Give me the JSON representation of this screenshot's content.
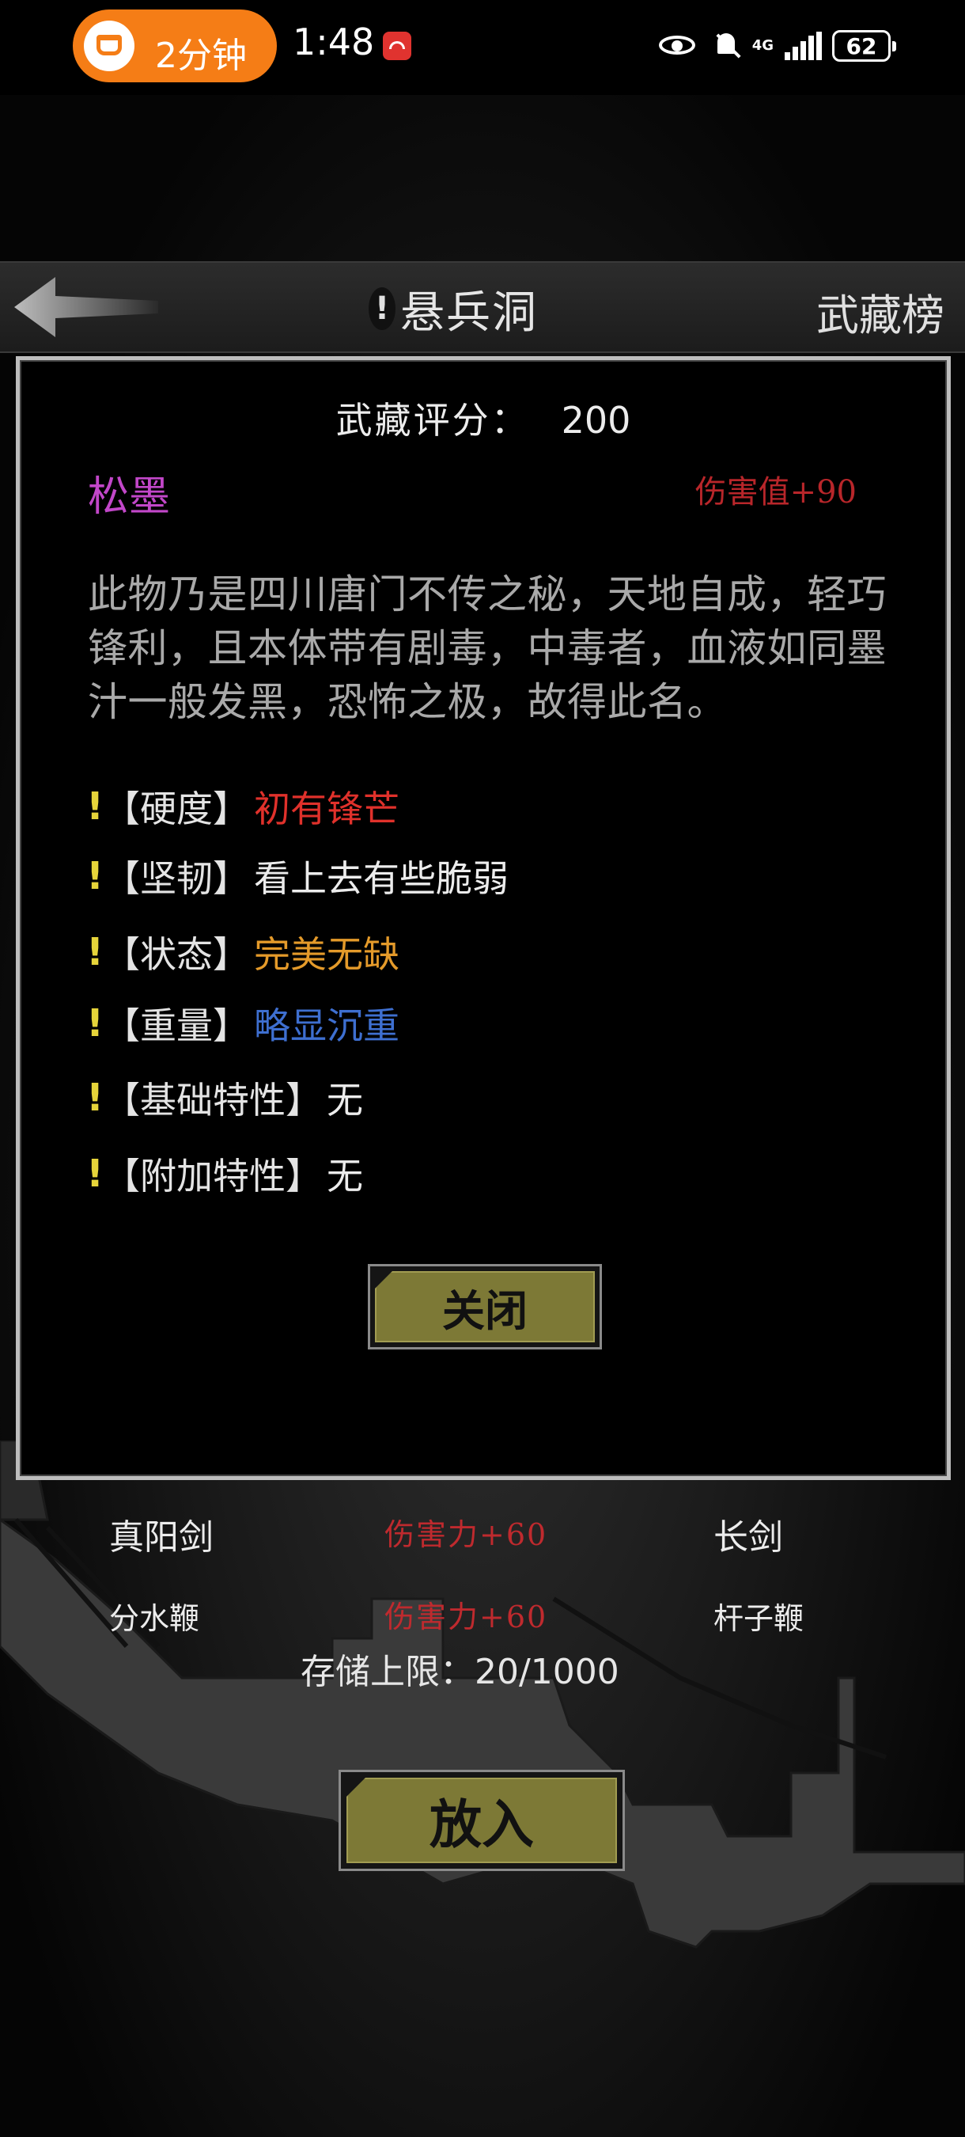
{
  "status_bar": {
    "pill_text": "2分钟",
    "time": "1:48",
    "network": "4G",
    "battery": "62"
  },
  "header": {
    "title": "悬兵洞",
    "title_icon": "exclamation-icon",
    "right_link": "武藏榜"
  },
  "detail": {
    "score_label": "武藏评分：",
    "score_value": "200",
    "item_name": "松墨",
    "damage_bonus": "伤害值+90",
    "description": "此物乃是四川唐门不传之秘，天地自成，轻巧锋利，且本体带有剧毒，中毒者，血液如同墨汁一般发黑，恐怖之极，故得此名。",
    "attributes": [
      {
        "label": "【硬度】",
        "value": "初有锋芒",
        "color": "#e0312b"
      },
      {
        "label": "【坚韧】",
        "value": "看上去有些脆弱",
        "color": "#ececec"
      },
      {
        "label": "【状态】",
        "value": "完美无缺",
        "color": "#e49a2a"
      },
      {
        "label": "【重量】",
        "value": "略显沉重",
        "color": "#3e6fd0"
      },
      {
        "label": "【基础特性】",
        "value": "无",
        "color": "#ececec"
      },
      {
        "label": "【附加特性】",
        "value": "无",
        "color": "#ececec"
      }
    ],
    "close_label": "关闭"
  },
  "weapons": [
    {
      "name": "真阳剑",
      "damage": "伤害力+60",
      "type": "长剑"
    },
    {
      "name": "分水鞭",
      "damage": "伤害力+60",
      "type": "杆子鞭"
    }
  ],
  "storage_text": "存储上限：20/1000",
  "put_label": "放入",
  "colors": {
    "accent_button": "#7d7936",
    "damage_red": "#bf2a2e",
    "item_name_purple": "#c247c9",
    "exclamation_yellow": "#e6d43a"
  }
}
